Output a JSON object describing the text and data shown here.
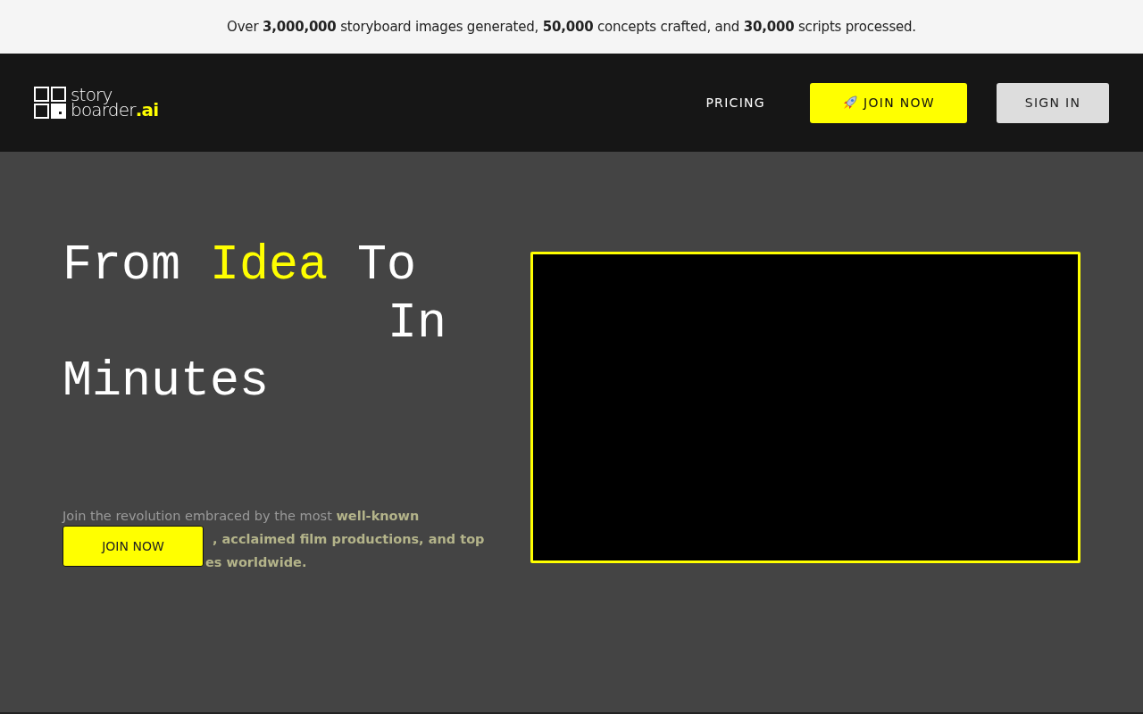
{
  "announcement": "Over **3,000,000** storyboard images generated, **50,000** concepts crafted, and **30,000** scripts processed.",
  "nav": {
    "logo": {
      "line1": "story",
      "line2": "boarder",
      "suffix": ".ai"
    },
    "links": [
      {
        "label": "PRICING",
        "kind": "link"
      },
      {
        "label": "JOIN NOW",
        "kind": "primary"
      },
      {
        "label": "SIGN IN",
        "kind": "secondary"
      }
    ]
  },
  "hero": {
    "headline": [
      {
        "text": "From ",
        "highlight": false
      },
      {
        "text": "Idea",
        "highlight": true
      },
      {
        "text": " To",
        "highlight": false
      },
      {
        "text": "In",
        "highlight": false,
        "kind": "right"
      },
      {
        "text": "Minutes",
        "highlight": false,
        "kind": "line"
      }
    ],
    "paragraph": [
      "Join the revolution embraced by the most **well-known**",
      "**, acclaimed film productions, and top**",
      "**es worldwide.**"
    ],
    "button": "JOIN NOW"
  }
}
